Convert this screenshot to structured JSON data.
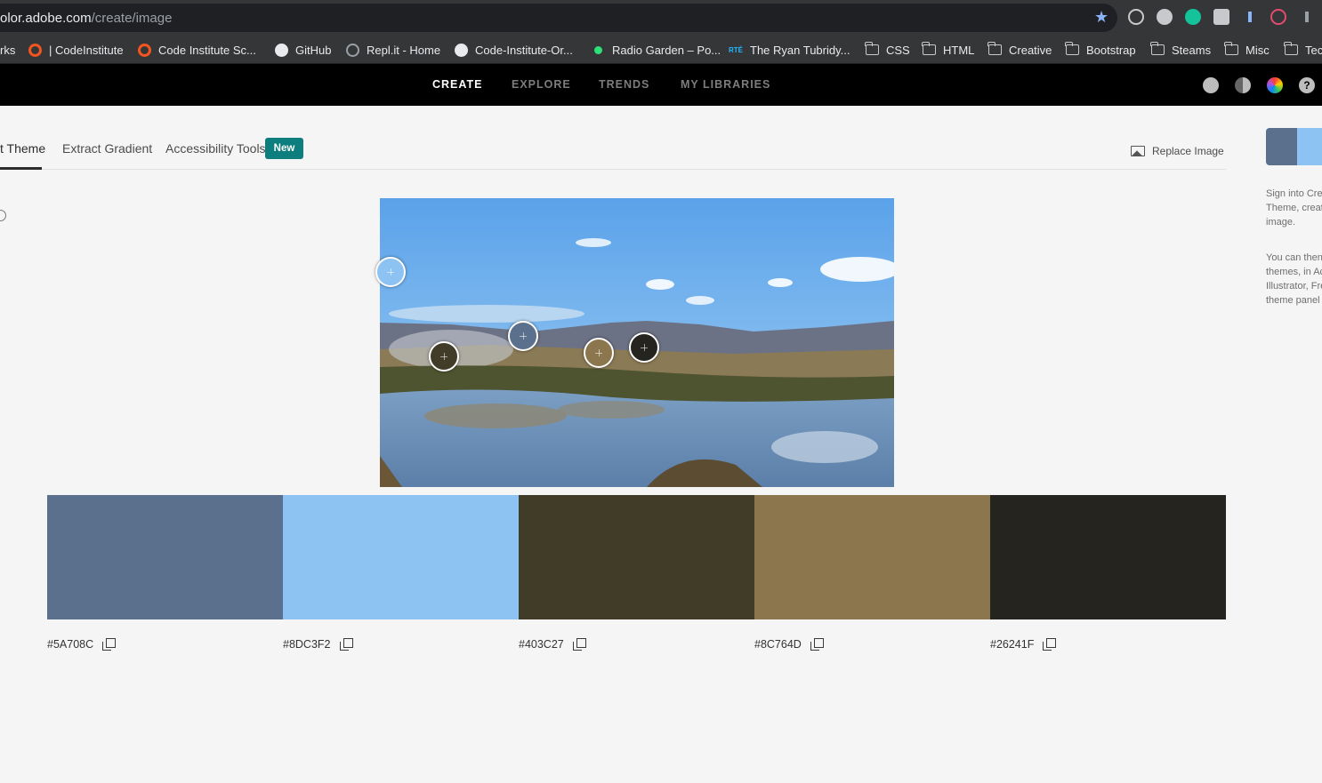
{
  "browser": {
    "url_host": "olor.adobe.com",
    "url_path": "/create/image",
    "bookmarks": [
      {
        "label": "rks",
        "icon": "none-icon"
      },
      {
        "label": "| CodeInstitute",
        "icon": "code-institute-icon"
      },
      {
        "label": "Code Institute Sc...",
        "icon": "code-institute-icon"
      },
      {
        "label": "GitHub",
        "icon": "github-icon"
      },
      {
        "label": "Repl.it - Home",
        "icon": "replit-icon"
      },
      {
        "label": "Code-Institute-Or...",
        "icon": "github-icon"
      },
      {
        "label": "Radio Garden – Po...",
        "icon": "radio-garden-icon"
      },
      {
        "label": "The Ryan Tubridy...",
        "icon": "rte-icon"
      },
      {
        "label": "CSS",
        "icon": "folder-icon"
      },
      {
        "label": "HTML",
        "icon": "folder-icon"
      },
      {
        "label": "Creative",
        "icon": "folder-icon"
      },
      {
        "label": "Bootstrap",
        "icon": "folder-icon"
      },
      {
        "label": "Steams",
        "icon": "folder-icon"
      },
      {
        "label": "Misc",
        "icon": "folder-icon"
      },
      {
        "label": "Tec",
        "icon": "folder-icon"
      }
    ]
  },
  "nav": {
    "items": [
      "CREATE",
      "EXPLORE",
      "TRENDS",
      "MY LIBRARIES"
    ],
    "active": "CREATE"
  },
  "tabs": {
    "items": [
      "t Theme",
      "Extract Gradient",
      "Accessibility Tools"
    ],
    "badge": "New",
    "replace_label": "Replace Image"
  },
  "swatches": [
    {
      "hex": "#5A708C"
    },
    {
      "hex": "#8DC3F2"
    },
    {
      "hex": "#403C27"
    },
    {
      "hex": "#8C764D"
    },
    {
      "hex": "#26241F"
    }
  ],
  "pickers": [
    {
      "color": "#8DC3F2"
    },
    {
      "color": "#403C27"
    },
    {
      "color": "#5A708C"
    },
    {
      "color": "#8C764D"
    },
    {
      "color": "#26241F"
    }
  ],
  "side_panel": {
    "para1": "Sign into Crea Theme, creat image.",
    "para2": "You can then themes, in Ac Illustrator, Fre theme panel"
  }
}
